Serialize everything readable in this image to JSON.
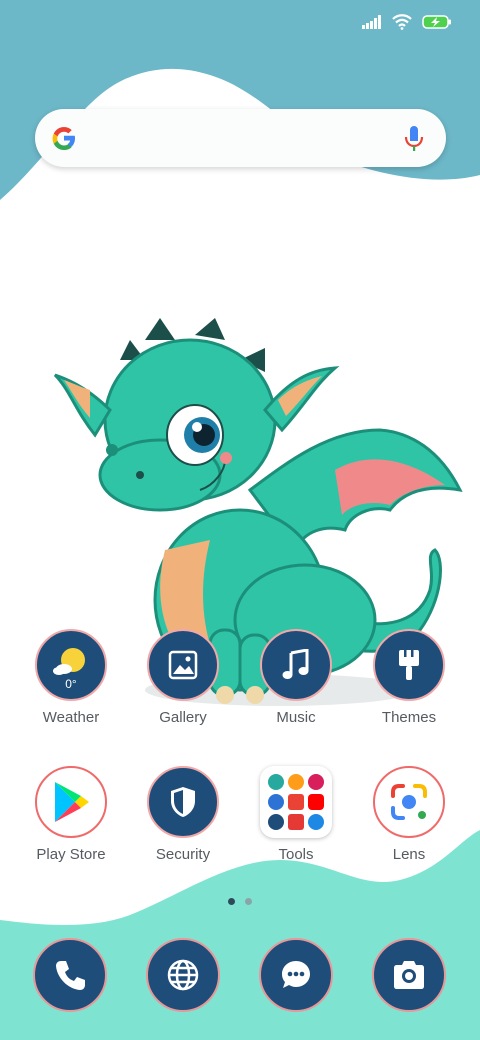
{
  "colors": {
    "top_wave": "#6cb7c8",
    "bottom_wave": "#7fe3d2",
    "icon_bg": "#1f4d7a",
    "icon_ring": "#f1a8a8",
    "label": "#555b61"
  },
  "status_bar": {
    "icons": [
      "signal-icon",
      "wifi-icon",
      "battery-charging-icon"
    ]
  },
  "search": {
    "placeholder": "",
    "left_icon": "google-g-icon",
    "right_icon": "microphone-icon"
  },
  "apps_row1": [
    {
      "label": "Weather",
      "icon": "weather-icon",
      "value": "0°"
    },
    {
      "label": "Gallery",
      "icon": "gallery-icon"
    },
    {
      "label": "Music",
      "icon": "music-icon"
    },
    {
      "label": "Themes",
      "icon": "themes-brush-icon"
    }
  ],
  "apps_row2": [
    {
      "label": "Play Store",
      "icon": "play-store-icon"
    },
    {
      "label": "Security",
      "icon": "shield-icon"
    },
    {
      "label": "Tools",
      "icon": "tools-folder-icon"
    },
    {
      "label": "Lens",
      "icon": "lens-icon"
    }
  ],
  "page_indicator": {
    "pages": 2,
    "current": 1
  },
  "dock": [
    {
      "icon": "phone-icon"
    },
    {
      "icon": "globe-icon"
    },
    {
      "icon": "messages-icon"
    },
    {
      "icon": "camera-icon"
    }
  ]
}
